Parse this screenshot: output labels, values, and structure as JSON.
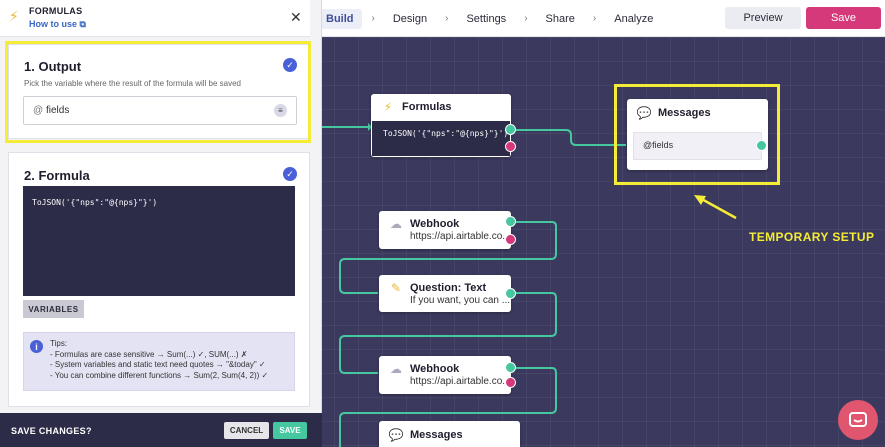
{
  "nav": {
    "steps": [
      {
        "label": "Build",
        "active": true
      },
      {
        "label": "Design",
        "active": false
      },
      {
        "label": "Settings",
        "active": false
      },
      {
        "label": "Share",
        "active": false
      },
      {
        "label": "Analyze",
        "active": false
      }
    ],
    "preview_label": "Preview",
    "save_label": "Save"
  },
  "panel": {
    "title": "FORMULAS",
    "how_to_use": "How to use",
    "output": {
      "heading": "1. Output",
      "description": "Pick the variable where the result of the formula will be saved",
      "variable": "fields",
      "at_symbol": "@"
    },
    "formula": {
      "heading": "2. Formula",
      "code": "ToJSON('{\"nps\":\"@{nps}\"}')",
      "variables_label": "VARIABLES"
    },
    "tips": {
      "title": "Tips:",
      "lines": [
        "- Formulas are case sensitive → Sum(...) ✓, SUM(...) ✗",
        "- System variables and static text need quotes → \"&today\" ✓",
        "- You can combine different functions → Sum(2, Sum(4, 2)) ✓"
      ]
    },
    "footer": {
      "label": "SAVE CHANGES?",
      "cancel_label": "CANCEL",
      "save_label": "SAVE"
    }
  },
  "nodes": {
    "formulas": {
      "title": "Formulas",
      "body": "ToJSON('{\"nps\":\"@{nps}\"}')"
    },
    "messages_top": {
      "title": "Messages",
      "body": "@fields"
    },
    "webhook_1": {
      "title": "Webhook",
      "body": "https://api.airtable.co..."
    },
    "question_text": {
      "title": "Question: Text",
      "body": "If you want, you can ..."
    },
    "webhook_2": {
      "title": "Webhook",
      "body": "https://api.airtable.co..."
    },
    "messages_bottom": {
      "title": "Messages"
    }
  },
  "annotation": "TEMPORARY SETUP",
  "colors": {
    "accent_pink": "#d5397a",
    "port_green": "#45c7a0",
    "highlight_yellow": "#f4ec37",
    "canvas_bg": "#3b3a5e",
    "check_blue": "#4a60d6"
  }
}
